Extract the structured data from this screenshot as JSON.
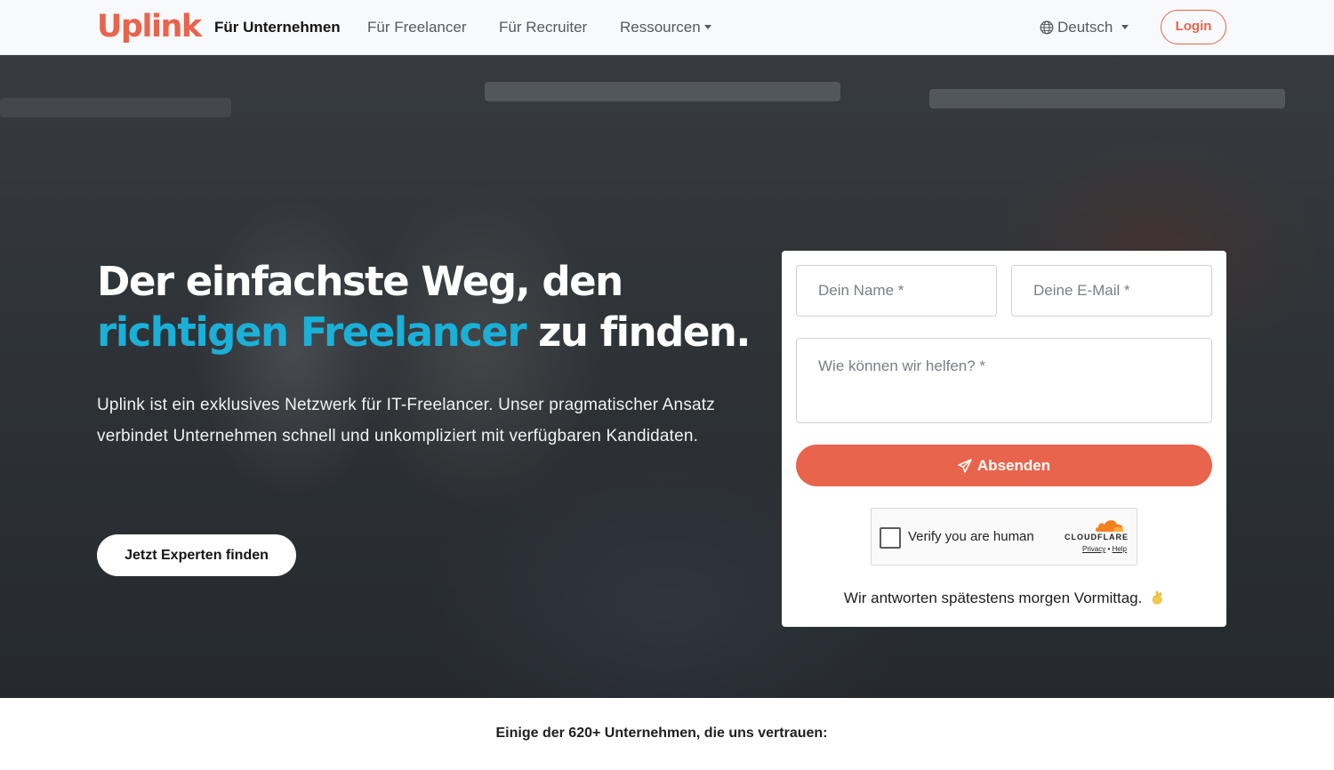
{
  "brand": {
    "logo_text": "Uplink",
    "accent_color": "#e8644c",
    "highlight_color": "#1ab0d8"
  },
  "nav": {
    "items": [
      {
        "label": "Für Unternehmen",
        "active": true
      },
      {
        "label": "Für Freelancer",
        "active": false
      },
      {
        "label": "Für Recruiter",
        "active": false
      },
      {
        "label": "Ressourcen",
        "active": false,
        "dropdown": true
      }
    ],
    "language": {
      "icon": "globe-icon",
      "label": "Deutsch"
    },
    "login_label": "Login"
  },
  "hero": {
    "title_line1": "Der einfachste Weg, den",
    "title_highlight": "richtigen Freelancer",
    "title_rest": " zu finden.",
    "description": "Uplink ist ein exklusives Netzwerk für IT-Freelancer. Unser pragmatischer Ansatz verbindet Unternehmen schnell und unkompliziert mit verfügbaren Kandidaten.",
    "cta_label": "Jetzt Experten finden"
  },
  "form": {
    "name_placeholder": "Dein Name *",
    "email_placeholder": "Deine E-Mail *",
    "message_placeholder": "Wie können wir helfen? *",
    "submit_label": "Absenden",
    "submit_icon": "paper-plane-icon",
    "captcha": {
      "label": "Verify you are human",
      "brand": "CLOUDFLARE",
      "privacy": "Privacy",
      "separator": "•",
      "help": "Help"
    },
    "reply_note": "Wir antworten spätestens morgen Vormittag."
  },
  "trust": {
    "text": "Einige der 620+ Unternehmen, die uns vertrauen:"
  }
}
